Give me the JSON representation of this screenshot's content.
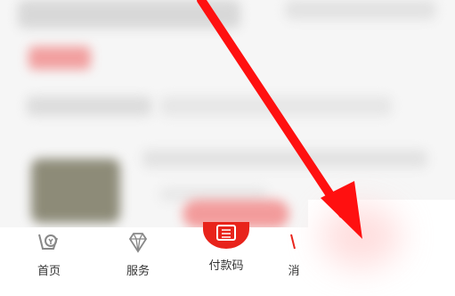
{
  "nav": {
    "tabs": [
      {
        "label": "首页",
        "icon": "home-coin-icon"
      },
      {
        "label": "服务",
        "icon": "diamond-icon"
      },
      {
        "label": "付款码",
        "icon": "scan-pay-icon"
      },
      {
        "label": "消",
        "icon": "partial-icon"
      }
    ]
  },
  "colors": {
    "accent": "#e8231b",
    "arrow": "#ff1010"
  }
}
